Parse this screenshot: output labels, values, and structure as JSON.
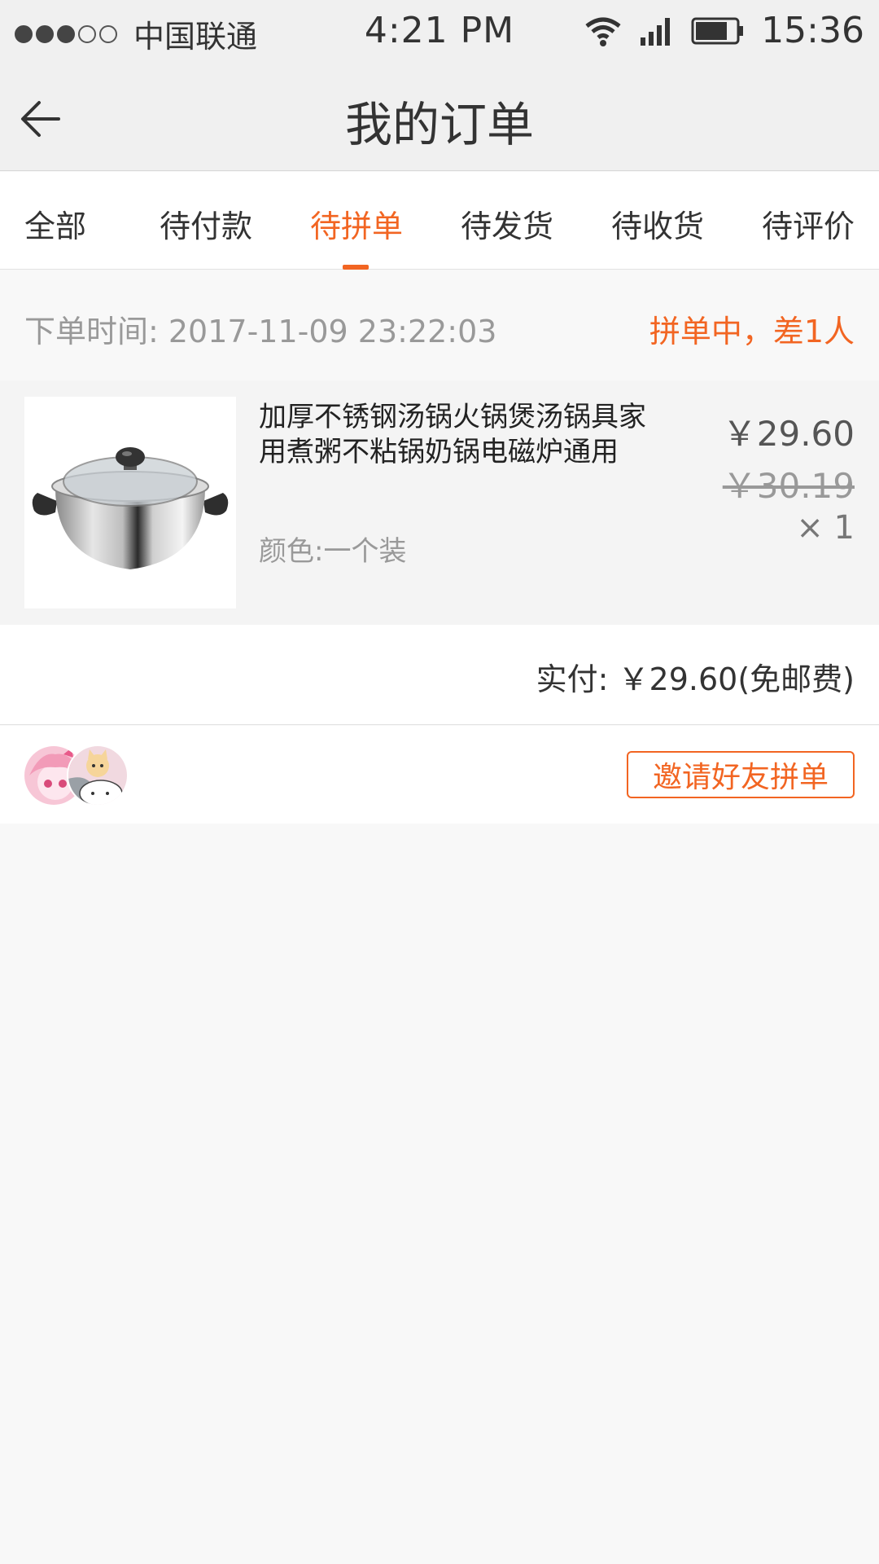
{
  "status_bar": {
    "carrier": "中国联通",
    "time": "4:21 PM",
    "clock": "15:36"
  },
  "header": {
    "title": "我的订单"
  },
  "tabs": [
    {
      "label": "全部"
    },
    {
      "label": "待付款"
    },
    {
      "label": "待拼单"
    },
    {
      "label": "待发货"
    },
    {
      "label": "待收货"
    },
    {
      "label": "待评价"
    }
  ],
  "active_tab": "待拼单",
  "order": {
    "time_label": "下单时间: 2017-11-09  23:22:03",
    "status": "拼单中，差1人",
    "product": {
      "name": "加厚不锈钢汤锅火锅煲汤锅具家用煮粥不粘锅奶锅电磁炉通用",
      "spec": "颜色:一个装",
      "price": "￥29.60",
      "original_price": "￥30.19",
      "quantity": "× 1"
    },
    "payment": "实付: ￥29.60(免邮费)"
  },
  "invite_button": "邀请好友拼单",
  "colors": {
    "accent": "#f26522",
    "header_bg": "#f0f0f0",
    "page_bg": "#f8f8f8"
  }
}
